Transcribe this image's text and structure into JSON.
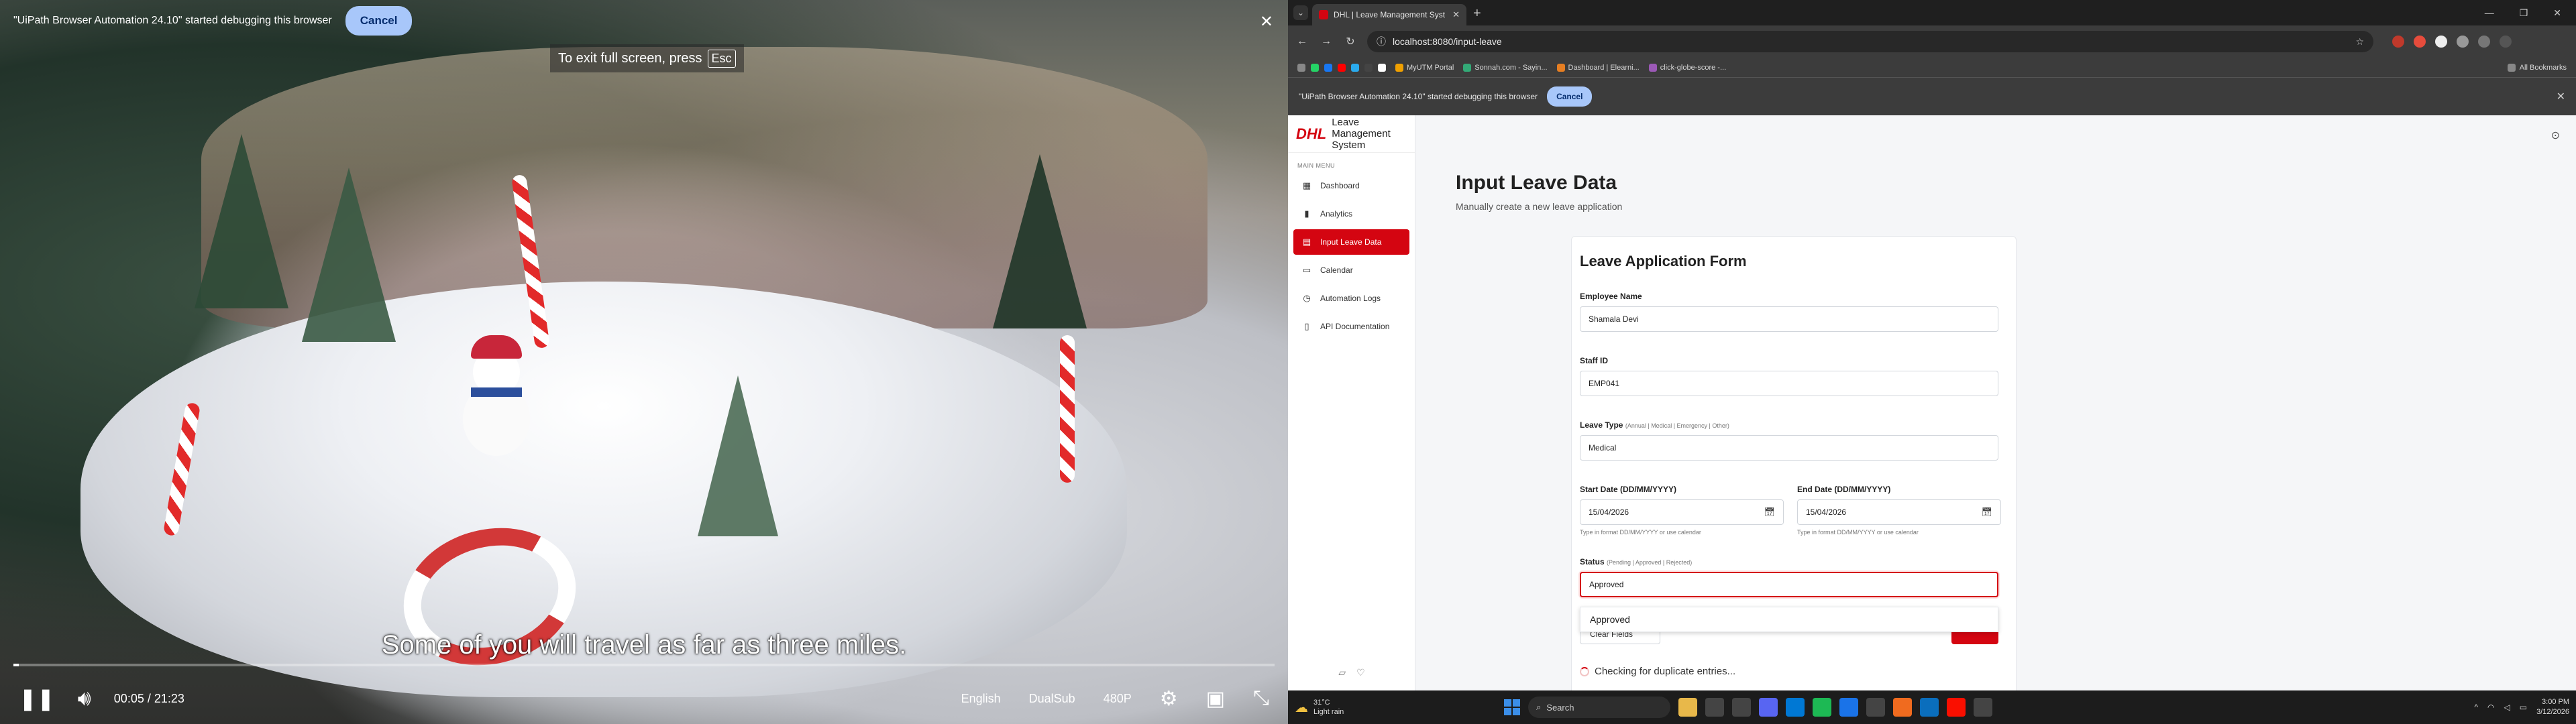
{
  "video": {
    "debug_text": "\"UiPath Browser Automation 24.10\" started debugging this browser",
    "debug_cancel": "Cancel",
    "fullscreen_hint": "To exit full screen, press",
    "fullscreen_key": "Esc",
    "subtitle": "Some of you will travel as far as three miles.",
    "time": "00:05 / 21:23",
    "progress": 0.004,
    "language": "English",
    "sub_mode": "DualSub",
    "quality": "480P"
  },
  "browser": {
    "tab_title": "DHL | Leave Management Syst",
    "url": "localhost:8080/input-leave",
    "bookmarks": [
      "MyUTM Portal",
      "Sonnah.com - Sayin...",
      "Dashboard | Elearni...",
      "click-globe-score -..."
    ],
    "all_bookmarks": "All Bookmarks",
    "debug_text": "\"UiPath Browser Automation 24.10\" started debugging this browser",
    "debug_cancel": "Cancel"
  },
  "app": {
    "logo": "DHL",
    "name": "Leave Management System",
    "menu_label": "MAIN MENU",
    "menu": [
      {
        "label": "Dashboard",
        "icon": "grid-icon"
      },
      {
        "label": "Analytics",
        "icon": "bar-chart-icon"
      },
      {
        "label": "Input Leave Data",
        "icon": "form-icon"
      },
      {
        "label": "Calendar",
        "icon": "calendar-icon"
      },
      {
        "label": "Automation Logs",
        "icon": "clock-icon"
      },
      {
        "label": "API Documentation",
        "icon": "document-icon"
      }
    ],
    "active_index": 2,
    "page_title": "Input Leave Data",
    "page_subtitle": "Manually create a new leave application",
    "form": {
      "title": "Leave Application Form",
      "employee_name_label": "Employee Name",
      "employee_name": "Shamala Devi",
      "staff_id_label": "Staff ID",
      "staff_id": "EMP041",
      "leave_type_label": "Leave Type",
      "leave_type_hint": "(Annual | Medical | Emergency | Other)",
      "leave_type": "Medical",
      "start_label": "Start Date (DD/MM/YYYY)",
      "start_value": "15/04/2026",
      "start_help": "Type in format DD/MM/YYYY or use calendar",
      "end_label": "End Date (DD/MM/YYYY)",
      "end_value": "15/04/2026",
      "end_help": "Type in format DD/MM/YYYY or use calendar",
      "status_label": "Status",
      "status_hint": "(Pending | Approved | Rejected)",
      "status_value": "Approved",
      "dropdown_option": "Approved",
      "clear_label": "Clear Fields",
      "checking_text": "Checking for duplicate entries..."
    }
  },
  "taskbar": {
    "temp": "31°C",
    "condition": "Light rain",
    "search": "Search",
    "time": "3:00 PM",
    "date": "3/12/2026"
  }
}
